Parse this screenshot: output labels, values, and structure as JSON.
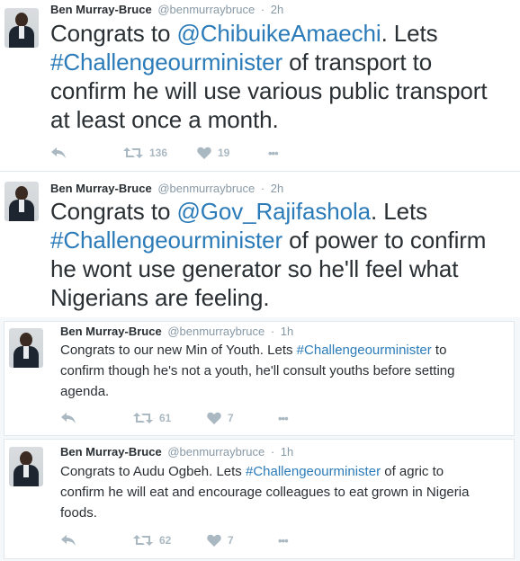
{
  "tweets": [
    {
      "name": "Ben Murray-Bruce",
      "handle": "@benmurraybruce",
      "separator": "·",
      "time": "2h",
      "text": {
        "t1": "Congrats to ",
        "mention": "@ChibuikeAmaechi",
        "t2": ". Lets ",
        "hashtag": "#Challengeourminister",
        "t3": " of transport to confirm he will use various public transport at least once a month."
      },
      "retweets": "136",
      "likes": "19",
      "more": "•••"
    },
    {
      "name": "Ben Murray-Bruce",
      "handle": "@benmurraybruce",
      "separator": "·",
      "time": "2h",
      "text": {
        "t1": "Congrats to ",
        "mention": "@Gov_Rajifashola",
        "t2": ". Lets ",
        "hashtag": "#Challengeourminister",
        "t3": " of power to confirm he wont use generator so he'll feel what Nigerians are feeling."
      }
    },
    {
      "name": "Ben Murray-Bruce",
      "handle": "@benmurraybruce",
      "separator": "·",
      "time": "1h",
      "text": {
        "t1": "Congrats to our new Min of Youth. Lets ",
        "hashtag": "#Challengeourminister",
        "t3": " to confirm though he's not a youth, he'll consult youths before setting agenda."
      },
      "retweets": "61",
      "likes": "7",
      "more": "•••"
    },
    {
      "name": "Ben Murray-Bruce",
      "handle": "@benmurraybruce",
      "separator": "·",
      "time": "1h",
      "text": {
        "t1": "Congrats to Audu Ogbeh. Lets ",
        "hashtag": "#Challengeourminister",
        "t3": " of agric to confirm he will eat and encourage colleagues to eat grown in Nigeria foods."
      },
      "retweets": "62",
      "likes": "7",
      "more": "•••"
    }
  ],
  "colors": {
    "link": "#2b7bb9",
    "meta": "#8899a6",
    "icon": "#aab8c2"
  },
  "icons": [
    "reply-icon",
    "retweet-icon",
    "heart-icon",
    "more-icon"
  ]
}
